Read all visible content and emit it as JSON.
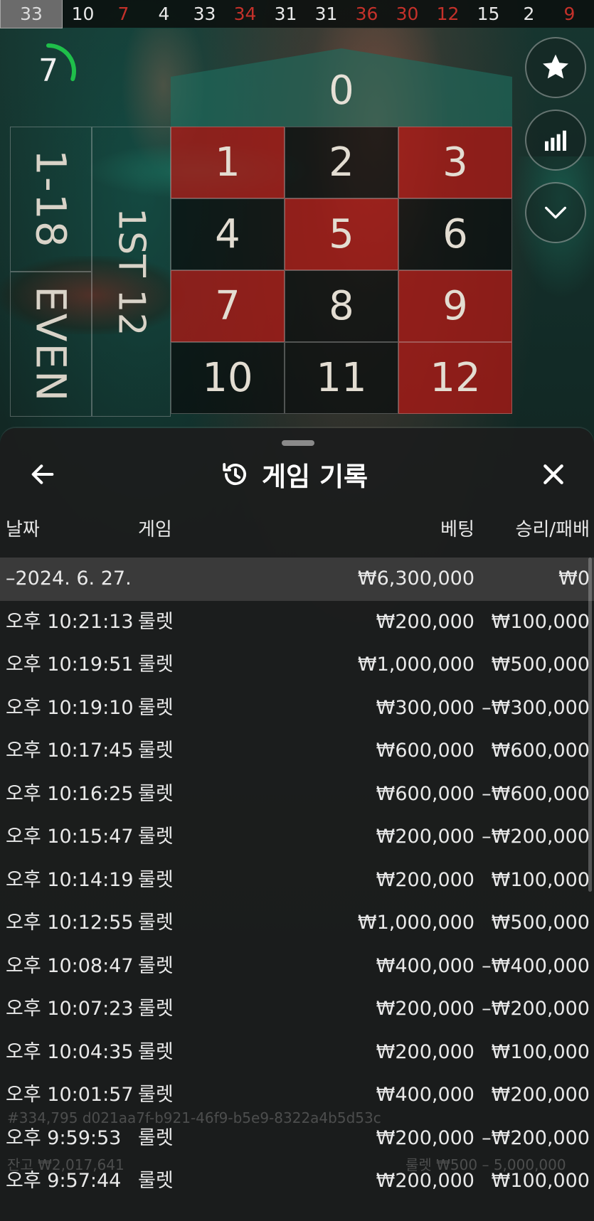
{
  "history_strip": [
    {
      "n": "33",
      "color": "grey"
    },
    {
      "n": "10",
      "color": "black"
    },
    {
      "n": "7",
      "color": "red"
    },
    {
      "n": "4",
      "color": "black"
    },
    {
      "n": "33",
      "color": "black"
    },
    {
      "n": "34",
      "color": "red"
    },
    {
      "n": "31",
      "color": "black"
    },
    {
      "n": "31",
      "color": "black"
    },
    {
      "n": "36",
      "color": "red"
    },
    {
      "n": "30",
      "color": "red"
    },
    {
      "n": "12",
      "color": "red"
    },
    {
      "n": "15",
      "color": "black"
    },
    {
      "n": "2",
      "color": "black"
    },
    {
      "n": "9",
      "color": "red"
    }
  ],
  "timer": {
    "seconds": "7",
    "progress": 0.3
  },
  "side_buttons": [
    {
      "icon": "star-icon"
    },
    {
      "icon": "stats-icon"
    },
    {
      "icon": "chevron-down-icon"
    }
  ],
  "board": {
    "zero": "0",
    "numbers": [
      {
        "n": "1",
        "color": "red"
      },
      {
        "n": "2",
        "color": "black"
      },
      {
        "n": "3",
        "color": "red"
      },
      {
        "n": "4",
        "color": "black"
      },
      {
        "n": "5",
        "color": "red"
      },
      {
        "n": "6",
        "color": "black"
      },
      {
        "n": "7",
        "color": "red"
      },
      {
        "n": "8",
        "color": "black"
      },
      {
        "n": "9",
        "color": "red"
      },
      {
        "n": "10",
        "color": "black"
      },
      {
        "n": "11",
        "color": "black"
      },
      {
        "n": "12",
        "color": "red"
      }
    ],
    "outside_1_18": "1-18",
    "outside_even": "EVEN",
    "outside_dozen": "1ST 12"
  },
  "panel": {
    "title": "게임 기록",
    "columns": {
      "date": "날짜",
      "game": "게임",
      "bet": "베팅",
      "win": "승리/패배"
    },
    "summary": {
      "date": "–2024. 6. 27.",
      "bet": "₩6,300,000",
      "win": "₩0"
    },
    "rows": [
      {
        "time": "오후 10:21:13",
        "game": "룰렛",
        "bet": "₩200,000",
        "win": "₩100,000"
      },
      {
        "time": "오후 10:19:51",
        "game": "룰렛",
        "bet": "₩1,000,000",
        "win": "₩500,000"
      },
      {
        "time": "오후 10:19:10",
        "game": "룰렛",
        "bet": "₩300,000",
        "win": "–₩300,000"
      },
      {
        "time": "오후 10:17:45",
        "game": "룰렛",
        "bet": "₩600,000",
        "win": "₩600,000"
      },
      {
        "time": "오후 10:16:25",
        "game": "룰렛",
        "bet": "₩600,000",
        "win": "–₩600,000"
      },
      {
        "time": "오후 10:15:47",
        "game": "룰렛",
        "bet": "₩200,000",
        "win": "–₩200,000"
      },
      {
        "time": "오후 10:14:19",
        "game": "룰렛",
        "bet": "₩200,000",
        "win": "₩100,000"
      },
      {
        "time": "오후 10:12:55",
        "game": "룰렛",
        "bet": "₩1,000,000",
        "win": "₩500,000"
      },
      {
        "time": "오후 10:08:47",
        "game": "룰렛",
        "bet": "₩400,000",
        "win": "–₩400,000"
      },
      {
        "time": "오후 10:07:23",
        "game": "룰렛",
        "bet": "₩200,000",
        "win": "–₩200,000"
      },
      {
        "time": "오후 10:04:35",
        "game": "룰렛",
        "bet": "₩200,000",
        "win": "₩100,000"
      },
      {
        "time": "오후 10:01:57",
        "game": "룰렛",
        "bet": "₩400,000",
        "win": "₩200,000"
      },
      {
        "time": "오후 9:59:53",
        "game": "룰렛",
        "bet": "₩200,000",
        "win": "–₩200,000"
      },
      {
        "time": "오후 9:57:44",
        "game": "룰렛",
        "bet": "₩200,000",
        "win": "₩100,000"
      }
    ]
  },
  "ghost_text": {
    "session_id": "#334,795 d021aa7f-b921-46f9-b5e9-8322a4b5d53c",
    "balance_line": "잔고 ₩2,017,641",
    "limits_line": "룰렛 ₩500 – 5,000,000"
  },
  "colors": {
    "red": "#aa1814",
    "black": "#080c0c",
    "green": "#1e6e5f",
    "panel": "#1c1d1d",
    "timer_ring": "#1fbf4a"
  }
}
